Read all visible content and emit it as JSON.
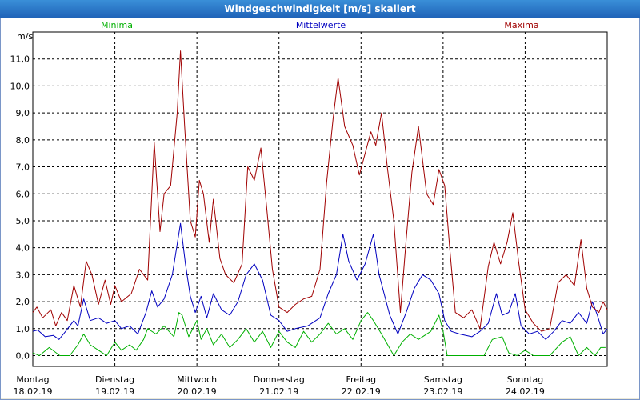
{
  "window": {
    "title": "Windgeschwindigkeit [m/s] skaliert"
  },
  "colors": {
    "minima": "#00b000",
    "mittel": "#0000c0",
    "maxima": "#a00000",
    "grid": "#000000"
  },
  "chart_data": {
    "type": "line",
    "title": "Windgeschwindigkeit [m/s] skaliert",
    "ylabel": "m/s",
    "ylim": [
      -0.4,
      12.0
    ],
    "yticks": [
      "0,0",
      "1,0",
      "2,0",
      "3,0",
      "4,0",
      "5,0",
      "6,0",
      "7,0",
      "8,0",
      "9,0",
      "10,0",
      "11,0"
    ],
    "ytick_values": [
      0,
      1,
      2,
      3,
      4,
      5,
      6,
      7,
      8,
      9,
      10,
      11
    ],
    "x_range": [
      0,
      7
    ],
    "days": [
      {
        "day": "Montag",
        "date": "18.02.19",
        "x": 0
      },
      {
        "day": "Dienstag",
        "date": "19.02.19",
        "x": 1
      },
      {
        "day": "Mittwoch",
        "date": "20.02.19",
        "x": 2
      },
      {
        "day": "Donnerstag",
        "date": "21.02.19",
        "x": 3
      },
      {
        "day": "Freitag",
        "date": "22.02.19",
        "x": 4
      },
      {
        "day": "Samstag",
        "date": "23.02.19",
        "x": 5
      },
      {
        "day": "Sonntag",
        "date": "24.02.19",
        "x": 6
      }
    ],
    "grid": true,
    "series": [
      {
        "name": "Minima",
        "color": "#00b000",
        "points": [
          [
            0,
            0.1
          ],
          [
            0.08,
            0.0
          ],
          [
            0.2,
            0.3
          ],
          [
            0.33,
            0.0
          ],
          [
            0.45,
            0.0
          ],
          [
            0.55,
            0.4
          ],
          [
            0.62,
            0.8
          ],
          [
            0.7,
            0.4
          ],
          [
            0.8,
            0.2
          ],
          [
            0.9,
            0.0
          ],
          [
            1.0,
            0.5
          ],
          [
            1.08,
            0.2
          ],
          [
            1.18,
            0.4
          ],
          [
            1.26,
            0.2
          ],
          [
            1.35,
            0.6
          ],
          [
            1.4,
            1.0
          ],
          [
            1.5,
            0.8
          ],
          [
            1.6,
            1.1
          ],
          [
            1.72,
            0.7
          ],
          [
            1.78,
            1.6
          ],
          [
            1.82,
            1.5
          ],
          [
            1.9,
            0.7
          ],
          [
            2.0,
            1.3
          ],
          [
            2.05,
            0.6
          ],
          [
            2.12,
            1.0
          ],
          [
            2.2,
            0.4
          ],
          [
            2.3,
            0.8
          ],
          [
            2.4,
            0.3
          ],
          [
            2.5,
            0.6
          ],
          [
            2.6,
            1.0
          ],
          [
            2.7,
            0.5
          ],
          [
            2.8,
            0.9
          ],
          [
            2.9,
            0.3
          ],
          [
            3.0,
            0.9
          ],
          [
            3.1,
            0.5
          ],
          [
            3.2,
            0.3
          ],
          [
            3.3,
            0.9
          ],
          [
            3.4,
            0.5
          ],
          [
            3.5,
            0.8
          ],
          [
            3.6,
            1.2
          ],
          [
            3.7,
            0.8
          ],
          [
            3.8,
            1.0
          ],
          [
            3.9,
            0.6
          ],
          [
            4.0,
            1.3
          ],
          [
            4.08,
            1.6
          ],
          [
            4.15,
            1.3
          ],
          [
            4.25,
            0.8
          ],
          [
            4.4,
            0.0
          ],
          [
            4.5,
            0.5
          ],
          [
            4.6,
            0.8
          ],
          [
            4.7,
            0.6
          ],
          [
            4.85,
            0.9
          ],
          [
            4.95,
            1.5
          ],
          [
            5.0,
            0.9
          ],
          [
            5.05,
            0.0
          ],
          [
            5.3,
            0.0
          ],
          [
            5.5,
            0.0
          ],
          [
            5.6,
            0.6
          ],
          [
            5.72,
            0.7
          ],
          [
            5.8,
            0.1
          ],
          [
            5.9,
            0.0
          ],
          [
            6.0,
            0.2
          ],
          [
            6.1,
            0.0
          ],
          [
            6.2,
            0.0
          ],
          [
            6.3,
            0.0
          ],
          [
            6.45,
            0.5
          ],
          [
            6.55,
            0.7
          ],
          [
            6.65,
            0.0
          ],
          [
            6.75,
            0.3
          ],
          [
            6.85,
            0.0
          ],
          [
            6.92,
            0.3
          ],
          [
            6.98,
            0.3
          ]
        ]
      },
      {
        "name": "Mittelwerte",
        "color": "#0000c0",
        "points": [
          [
            0,
            0.9
          ],
          [
            0.06,
            0.95
          ],
          [
            0.15,
            0.7
          ],
          [
            0.25,
            0.75
          ],
          [
            0.32,
            0.6
          ],
          [
            0.4,
            0.9
          ],
          [
            0.5,
            1.3
          ],
          [
            0.55,
            1.1
          ],
          [
            0.62,
            2.1
          ],
          [
            0.7,
            1.3
          ],
          [
            0.8,
            1.4
          ],
          [
            0.9,
            1.2
          ],
          [
            1.0,
            1.3
          ],
          [
            1.08,
            1.0
          ],
          [
            1.18,
            1.1
          ],
          [
            1.28,
            0.8
          ],
          [
            1.38,
            1.6
          ],
          [
            1.45,
            2.4
          ],
          [
            1.52,
            1.8
          ],
          [
            1.6,
            2.1
          ],
          [
            1.7,
            3.0
          ],
          [
            1.8,
            4.9
          ],
          [
            1.86,
            3.4
          ],
          [
            1.92,
            2.2
          ],
          [
            1.98,
            1.6
          ],
          [
            2.05,
            2.2
          ],
          [
            2.12,
            1.4
          ],
          [
            2.2,
            2.3
          ],
          [
            2.3,
            1.7
          ],
          [
            2.4,
            1.5
          ],
          [
            2.5,
            2.0
          ],
          [
            2.6,
            3.0
          ],
          [
            2.7,
            3.4
          ],
          [
            2.8,
            2.8
          ],
          [
            2.9,
            1.5
          ],
          [
            3.0,
            1.3
          ],
          [
            3.1,
            0.9
          ],
          [
            3.2,
            1.0
          ],
          [
            3.35,
            1.1
          ],
          [
            3.5,
            1.4
          ],
          [
            3.6,
            2.3
          ],
          [
            3.7,
            3.0
          ],
          [
            3.78,
            4.5
          ],
          [
            3.85,
            3.5
          ],
          [
            3.95,
            2.8
          ],
          [
            4.05,
            3.4
          ],
          [
            4.15,
            4.5
          ],
          [
            4.22,
            3.0
          ],
          [
            4.35,
            1.5
          ],
          [
            4.45,
            0.8
          ],
          [
            4.55,
            1.6
          ],
          [
            4.65,
            2.5
          ],
          [
            4.75,
            3.0
          ],
          [
            4.85,
            2.8
          ],
          [
            4.95,
            2.3
          ],
          [
            5.02,
            1.3
          ],
          [
            5.1,
            0.9
          ],
          [
            5.2,
            0.8
          ],
          [
            5.35,
            0.7
          ],
          [
            5.45,
            0.9
          ],
          [
            5.55,
            1.2
          ],
          [
            5.65,
            2.3
          ],
          [
            5.72,
            1.5
          ],
          [
            5.8,
            1.6
          ],
          [
            5.88,
            2.3
          ],
          [
            5.95,
            1.1
          ],
          [
            6.05,
            0.8
          ],
          [
            6.15,
            0.9
          ],
          [
            6.25,
            0.6
          ],
          [
            6.35,
            0.9
          ],
          [
            6.45,
            1.3
          ],
          [
            6.55,
            1.2
          ],
          [
            6.65,
            1.6
          ],
          [
            6.75,
            1.2
          ],
          [
            6.82,
            2.0
          ],
          [
            6.88,
            1.5
          ],
          [
            6.95,
            0.8
          ],
          [
            7.0,
            1.0
          ]
        ]
      },
      {
        "name": "Maxima",
        "color": "#a00000",
        "points": [
          [
            0,
            1.6
          ],
          [
            0.05,
            1.8
          ],
          [
            0.12,
            1.4
          ],
          [
            0.22,
            1.7
          ],
          [
            0.28,
            1.1
          ],
          [
            0.35,
            1.6
          ],
          [
            0.42,
            1.3
          ],
          [
            0.5,
            2.6
          ],
          [
            0.58,
            1.8
          ],
          [
            0.65,
            3.5
          ],
          [
            0.72,
            3.0
          ],
          [
            0.8,
            1.9
          ],
          [
            0.88,
            2.8
          ],
          [
            0.95,
            1.9
          ],
          [
            1.0,
            2.6
          ],
          [
            1.08,
            2.0
          ],
          [
            1.2,
            2.3
          ],
          [
            1.3,
            3.2
          ],
          [
            1.4,
            2.8
          ],
          [
            1.48,
            7.9
          ],
          [
            1.55,
            4.6
          ],
          [
            1.6,
            6.0
          ],
          [
            1.68,
            6.3
          ],
          [
            1.76,
            9.0
          ],
          [
            1.8,
            11.3
          ],
          [
            1.85,
            8.5
          ],
          [
            1.92,
            5.0
          ],
          [
            1.98,
            4.4
          ],
          [
            2.03,
            6.5
          ],
          [
            2.08,
            6.0
          ],
          [
            2.15,
            4.2
          ],
          [
            2.2,
            5.8
          ],
          [
            2.28,
            3.6
          ],
          [
            2.35,
            3.0
          ],
          [
            2.45,
            2.7
          ],
          [
            2.55,
            3.4
          ],
          [
            2.62,
            7.0
          ],
          [
            2.7,
            6.5
          ],
          [
            2.78,
            7.7
          ],
          [
            2.85,
            5.5
          ],
          [
            2.92,
            3.2
          ],
          [
            3.0,
            1.8
          ],
          [
            3.1,
            1.6
          ],
          [
            3.2,
            1.9
          ],
          [
            3.3,
            2.1
          ],
          [
            3.4,
            2.2
          ],
          [
            3.5,
            3.2
          ],
          [
            3.58,
            6.4
          ],
          [
            3.66,
            8.8
          ],
          [
            3.72,
            10.3
          ],
          [
            3.8,
            8.5
          ],
          [
            3.9,
            7.8
          ],
          [
            3.98,
            6.7
          ],
          [
            4.05,
            7.5
          ],
          [
            4.12,
            8.3
          ],
          [
            4.18,
            7.8
          ],
          [
            4.25,
            9.0
          ],
          [
            4.32,
            7.0
          ],
          [
            4.4,
            5.0
          ],
          [
            4.48,
            1.6
          ],
          [
            4.55,
            4.3
          ],
          [
            4.62,
            6.8
          ],
          [
            4.7,
            8.5
          ],
          [
            4.8,
            6.0
          ],
          [
            4.88,
            5.6
          ],
          [
            4.95,
            6.9
          ],
          [
            5.02,
            6.3
          ],
          [
            5.08,
            4.0
          ],
          [
            5.15,
            1.6
          ],
          [
            5.25,
            1.4
          ],
          [
            5.35,
            1.7
          ],
          [
            5.45,
            1.0
          ],
          [
            5.55,
            3.3
          ],
          [
            5.62,
            4.2
          ],
          [
            5.7,
            3.4
          ],
          [
            5.78,
            4.2
          ],
          [
            5.85,
            5.3
          ],
          [
            5.92,
            3.5
          ],
          [
            6.0,
            1.7
          ],
          [
            6.1,
            1.2
          ],
          [
            6.2,
            0.9
          ],
          [
            6.3,
            1.0
          ],
          [
            6.4,
            2.7
          ],
          [
            6.5,
            3.0
          ],
          [
            6.6,
            2.6
          ],
          [
            6.68,
            4.3
          ],
          [
            6.75,
            2.5
          ],
          [
            6.82,
            1.8
          ],
          [
            6.9,
            1.6
          ],
          [
            6.95,
            2.0
          ],
          [
            7.0,
            1.7
          ]
        ]
      }
    ]
  }
}
